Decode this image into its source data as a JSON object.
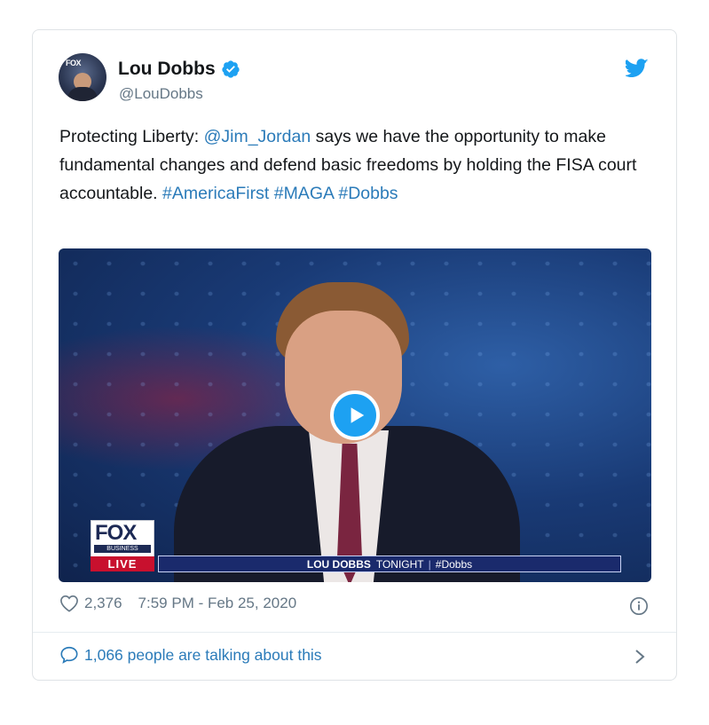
{
  "author": {
    "name": "Lou Dobbs",
    "handle": "@LouDobbs",
    "avatar_icon": "avatar-photo",
    "verified_icon": "verified-badge-icon"
  },
  "tweet": {
    "text_prefix": "Protecting Liberty: ",
    "mention": "@Jim_Jordan",
    "text_body": " says we have the opportunity to make fundamental changes and defend basic freedoms by holding the FISA court accountable. ",
    "hashtags": [
      "#AmericaFirst",
      "#MAGA",
      "#Dobbs"
    ]
  },
  "media": {
    "type": "video",
    "network_logo": "FOX",
    "network_sub": "BUSINESS",
    "live_label": "LIVE",
    "show_title": "LOU DOBBS",
    "show_suffix": "TONIGHT",
    "show_hashtag": "#Dobbs"
  },
  "meta": {
    "likes": "2,376",
    "time": "7:59 PM - Feb 25, 2020"
  },
  "conversation": {
    "label": "1,066 people are talking about this"
  },
  "colors": {
    "link": "#2b7bb9",
    "twitter_blue": "#1da1f2",
    "muted": "#657786"
  }
}
